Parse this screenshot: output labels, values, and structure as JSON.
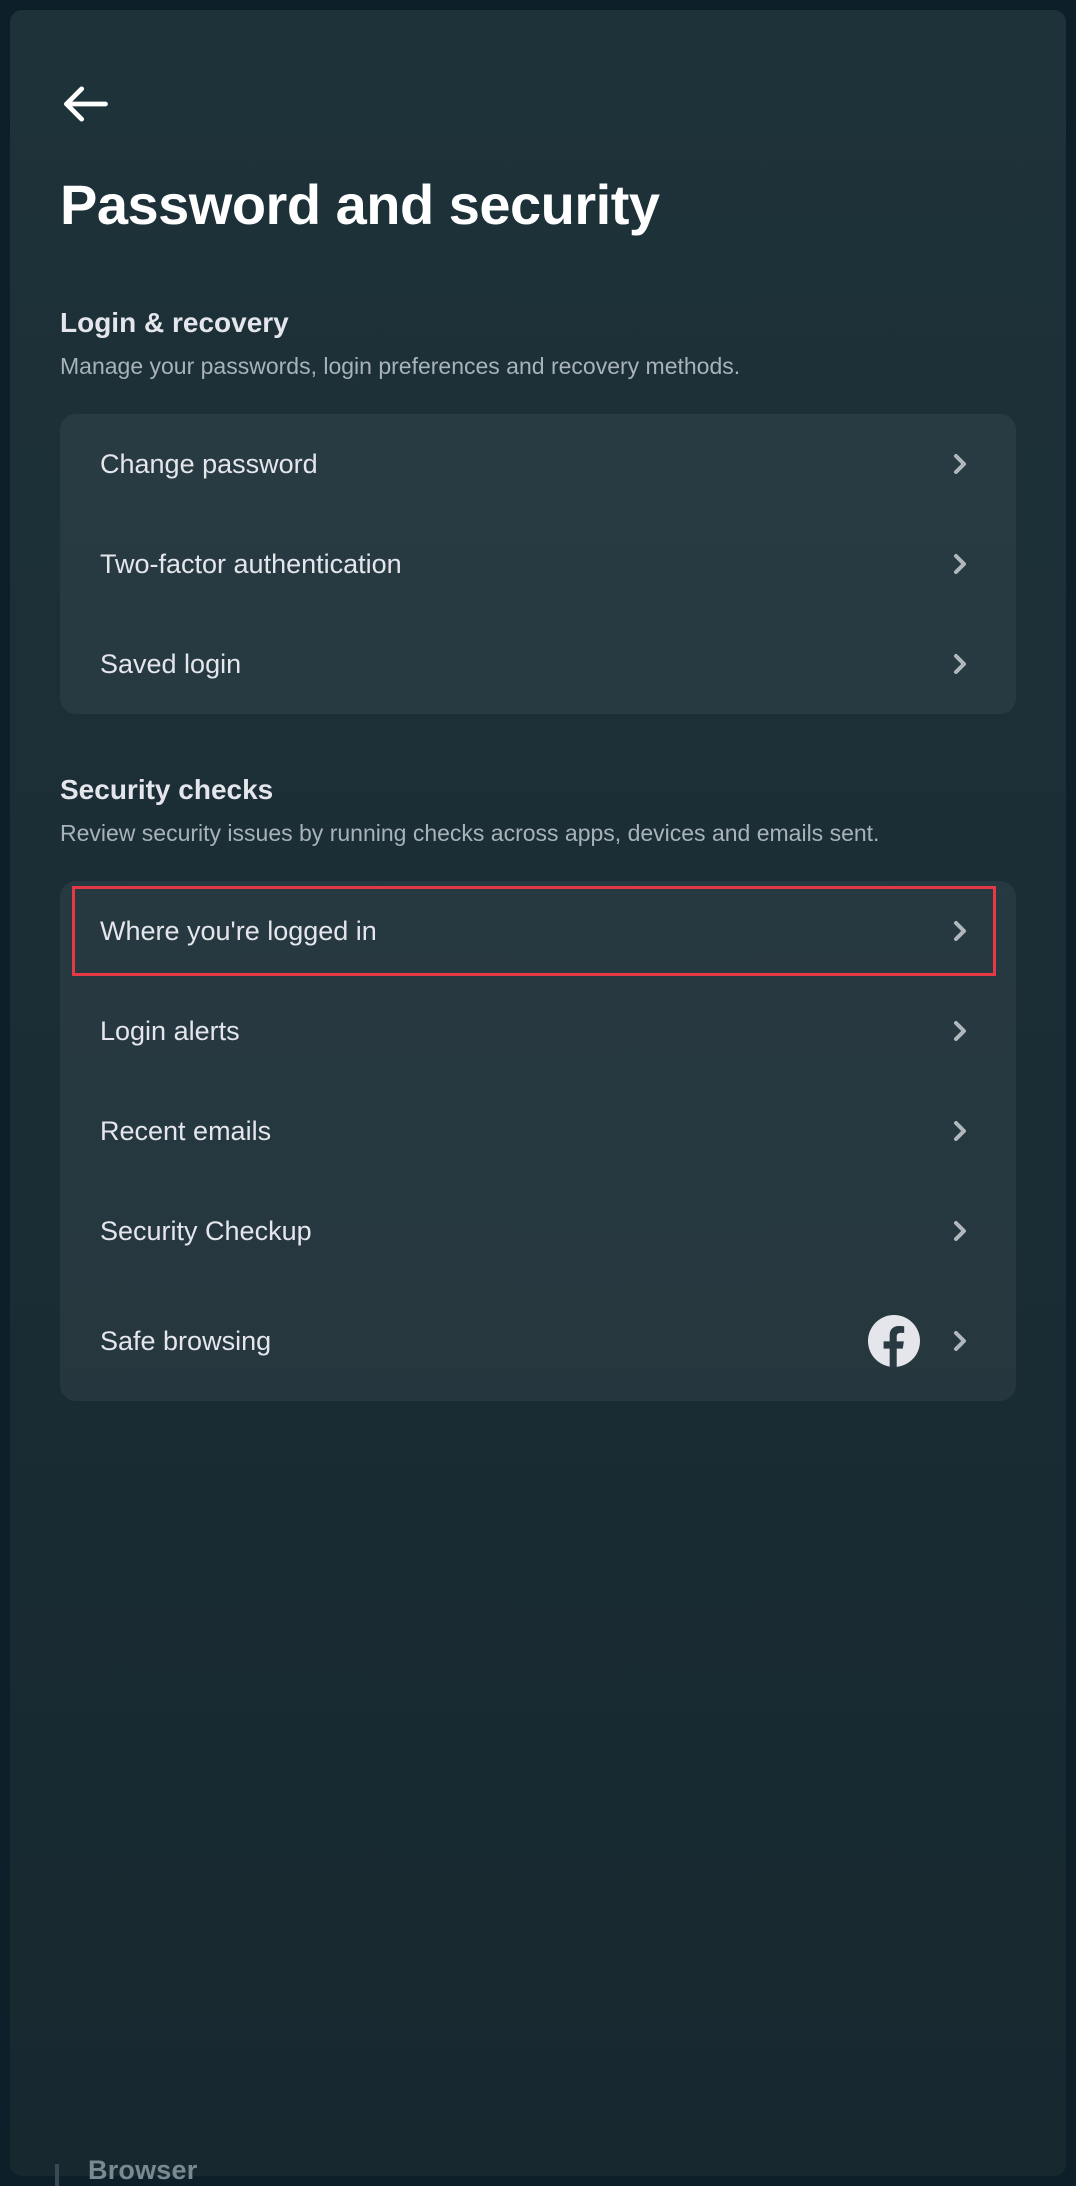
{
  "page": {
    "title": "Password and security"
  },
  "sections": [
    {
      "title": "Login & recovery",
      "description": "Manage your passwords, login preferences and recovery methods.",
      "items": [
        {
          "label": "Change password",
          "highlighted": false,
          "has_facebook_icon": false
        },
        {
          "label": "Two-factor authentication",
          "highlighted": false,
          "has_facebook_icon": false
        },
        {
          "label": "Saved login",
          "highlighted": false,
          "has_facebook_icon": false
        }
      ]
    },
    {
      "title": "Security checks",
      "description": "Review security issues by running checks across apps, devices and emails sent.",
      "items": [
        {
          "label": "Where you're logged in",
          "highlighted": true,
          "has_facebook_icon": false
        },
        {
          "label": "Login alerts",
          "highlighted": false,
          "has_facebook_icon": false
        },
        {
          "label": "Recent emails",
          "highlighted": false,
          "has_facebook_icon": false
        },
        {
          "label": "Security Checkup",
          "highlighted": false,
          "has_facebook_icon": false
        },
        {
          "label": "Safe browsing",
          "highlighted": false,
          "has_facebook_icon": true
        }
      ]
    }
  ],
  "fragment": {
    "text": "Browser"
  }
}
